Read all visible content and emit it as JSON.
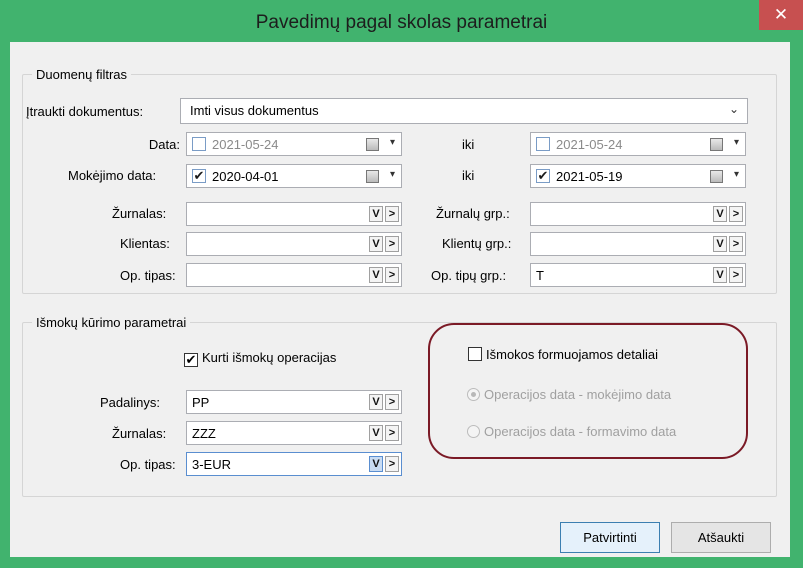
{
  "window": {
    "title": "Pavedimų pagal skolas parametrai",
    "close_glyph": "✕"
  },
  "filter": {
    "title": "Duomenų filtras",
    "include_label": "Įtraukti dokumentus:",
    "include_value": "Imti visus dokumentus",
    "date_label": "Data:",
    "date_from": "2021-05-24",
    "date_to_label": "iki",
    "date_to": "2021-05-24",
    "pay_date_label": "Mokėjimo data:",
    "pay_date_from": "2020-04-01",
    "pay_date_to_label": "iki",
    "pay_date_to": "2021-05-19",
    "journals_label": "Žurnalas:",
    "journals_value": "",
    "journal_groups_label": "Žurnalų grp.:",
    "journal_groups_value": "",
    "client_label": "Klientas:",
    "client_value": "",
    "client_groups_label": "Klientų grp.:",
    "client_groups_value": "",
    "op_type_label": "Op. tipas:",
    "op_type_value": "",
    "op_type_groups_label": "Op. tipų grp.:",
    "op_type_groups_value": "T"
  },
  "payout": {
    "title": "Išmokų kūrimo parametrai",
    "create_ops_label": "Kurti išmokų operacijas",
    "create_ops_checked": true,
    "detailed_label": "Išmokos formuojamos detaliai",
    "detailed_checked": false,
    "radio_pay_date_label": "Operacijos data - mokėjimo data",
    "radio_form_date_label": "Operacijos data - formavimo data",
    "division_label": "Padalinys:",
    "division_value": "PP",
    "journal_label": "Žurnalas:",
    "journal_value": "ZZZ",
    "op_type_label": "Op. tipas:",
    "op_type_value": "3-EUR"
  },
  "buttons": {
    "confirm": "Patvirtinti",
    "cancel": "Atšaukti"
  },
  "glyphs": {
    "check": "✔",
    "dropdown": "⌄",
    "filter_btn": "V",
    "next_btn": ">",
    "cal_drop": "▾"
  },
  "colors": {
    "title_bar": "#41b36e",
    "close": "#c75050",
    "highlight_oval": "#7b1a26"
  }
}
